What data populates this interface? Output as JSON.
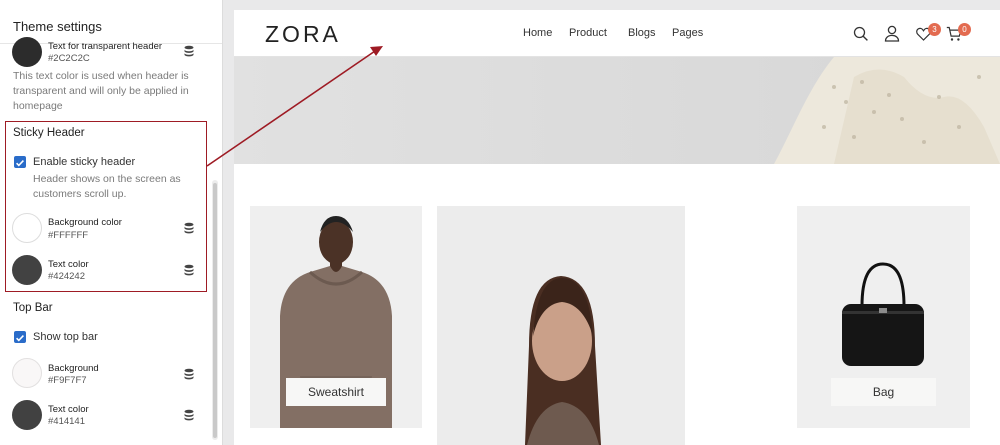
{
  "panel": {
    "title": "Theme settings",
    "transparent_text": {
      "name": "Text for transparent header",
      "hex": "#2C2C2C",
      "help": "This text color is used when header is transparent and will only be applied in homepage"
    },
    "sticky_header": {
      "title": "Sticky Header",
      "enable_label": "Enable sticky header",
      "enable_checked": true,
      "help": "Header shows on the screen as customers scroll up.",
      "background": {
        "name": "Background color",
        "hex": "#FFFFFF"
      },
      "text": {
        "name": "Text color",
        "hex": "#424242"
      }
    },
    "top_bar": {
      "title": "Top Bar",
      "show_label": "Show top bar",
      "show_checked": true,
      "background": {
        "name": "Background",
        "hex": "#F9F7F7"
      },
      "text": {
        "name": "Text color",
        "hex": "#414141"
      }
    }
  },
  "site": {
    "logo": "ZORA",
    "nav": [
      "Home",
      "Product",
      "Blogs",
      "Pages"
    ],
    "wishlist_count": "3",
    "cart_count": "0",
    "products": [
      {
        "label": "Sweatshirt"
      },
      {
        "label": "Bag"
      }
    ]
  },
  "colors": {
    "accent": "#2a6cc9",
    "highlight": "#9e1b24",
    "badge": "#e36b50"
  }
}
